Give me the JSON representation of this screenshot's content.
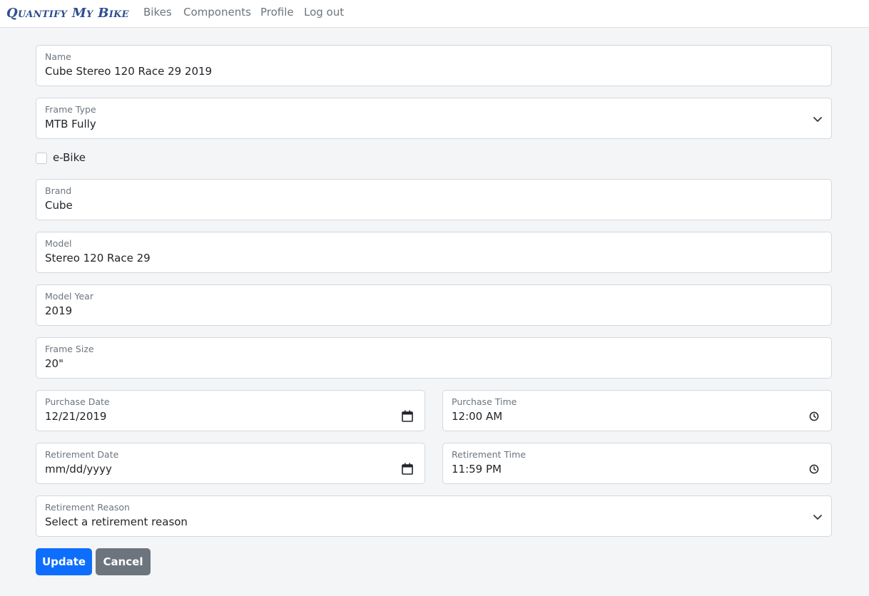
{
  "app": {
    "brand": "Quantify My Bike",
    "nav": [
      "Bikes",
      "Components",
      "Profile",
      "Log out"
    ]
  },
  "form": {
    "name": {
      "label": "Name",
      "value": "Cube Stereo 120 Race 29 2019"
    },
    "frame_type": {
      "label": "Frame Type",
      "value": "MTB Fully"
    },
    "ebike": {
      "label": "e-Bike",
      "checked": false
    },
    "brand": {
      "label": "Brand",
      "value": "Cube"
    },
    "model": {
      "label": "Model",
      "value": "Stereo 120 Race 29"
    },
    "model_year": {
      "label": "Model Year",
      "value": "2019"
    },
    "frame_size": {
      "label": "Frame Size",
      "value": "20\""
    },
    "purchase_date": {
      "label": "Purchase Date",
      "value": "12/21/2019",
      "icon": "calendar-icon"
    },
    "purchase_time": {
      "label": "Purchase Time",
      "value": "12:00 AM",
      "icon": "clock-icon"
    },
    "retirement_date": {
      "label": "Retirement Date",
      "value": "mm/dd/yyyy",
      "icon": "calendar-icon"
    },
    "retirement_time": {
      "label": "Retirement Time",
      "value": "11:59 PM",
      "icon": "clock-icon"
    },
    "retirement_reason": {
      "label": "Retirement Reason",
      "value": "Select a retirement reason"
    }
  },
  "actions": {
    "update": "Update",
    "cancel": "Cancel"
  },
  "colors": {
    "brand": "#2e4f8e",
    "primary": "#0d6efd",
    "secondary": "#6c757d",
    "background": "#f4f5f7"
  }
}
